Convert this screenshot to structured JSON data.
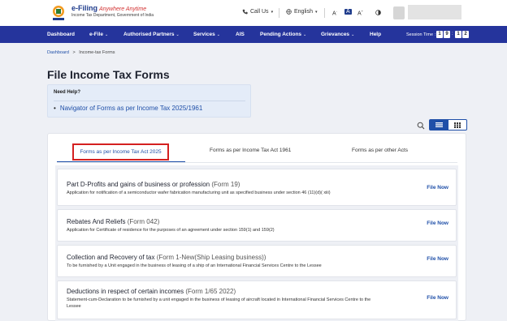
{
  "header": {
    "brand_title": "e-Filing",
    "brand_tagline": "Anywhere Anytime",
    "brand_subtitle": "Income Tax Department, Government of India",
    "call_us": "Call Us",
    "language": "English",
    "font_small": "A",
    "font_normal": "A",
    "font_large": "A",
    "font_small_sup": "-",
    "font_large_sup": "+"
  },
  "nav": {
    "items": [
      {
        "label": "Dashboard",
        "dropdown": false
      },
      {
        "label": "e-File",
        "dropdown": true
      },
      {
        "label": "Authorised Partners",
        "dropdown": true
      },
      {
        "label": "Services",
        "dropdown": true
      },
      {
        "label": "AIS",
        "dropdown": false
      },
      {
        "label": "Pending Actions",
        "dropdown": true
      },
      {
        "label": "Grievances",
        "dropdown": true
      },
      {
        "label": "Help",
        "dropdown": false
      }
    ],
    "session_label": "Session Time",
    "session_digits": [
      "1",
      "9",
      "1",
      "2"
    ]
  },
  "breadcrumb": {
    "home": "Dashboard",
    "separator": ">",
    "current": "Income-tax Forms"
  },
  "page_title": "File Income Tax Forms",
  "help": {
    "title": "Need Help?",
    "link": "Navigator of Forms as per Income Tax 2025/1961"
  },
  "tabs": [
    {
      "label": "Forms as per Income Tax Act 2025",
      "active": true
    },
    {
      "label": "Forms as per Income Tax Act 1961",
      "active": false
    },
    {
      "label": "Forms as per other Acts",
      "active": false
    }
  ],
  "forms": [
    {
      "title": "Part D-Profits and gains of business or profession",
      "form": "(Form 19)",
      "description": "Application for notification of a semiconductor wafer fabrication manufacturing unit as specified business under section 46 (11)(d)( xiii)",
      "action": "File Now"
    },
    {
      "title": "Rebates And Reliefs",
      "form": "(Form 042)",
      "description": "Application for Certificate of residence for the purposes of an agreement under section 159(1) and 159(2)",
      "action": "File Now"
    },
    {
      "title": "Collection and Recovery of tax",
      "form": "(Form 1-New(Ship Leasing business))",
      "description": "To be furnished by a Unit engaged in the business of leasing of a ship of an International Financial Services Centre to the Lessee",
      "action": "File Now"
    },
    {
      "title": "Deductions in respect of certain incomes",
      "form": "(Form 1/65 2022)",
      "description": "Statement-cum-Declaration to be furnished by a unit engaged in the business of leasing of aircraft located in International Financial Services Centre to the Lessee",
      "action": "File Now"
    }
  ],
  "colors": {
    "nav_bg": "#25349c",
    "accent": "#1f4fa8",
    "highlight_border": "#d42020",
    "page_bg": "#eef0f5"
  }
}
